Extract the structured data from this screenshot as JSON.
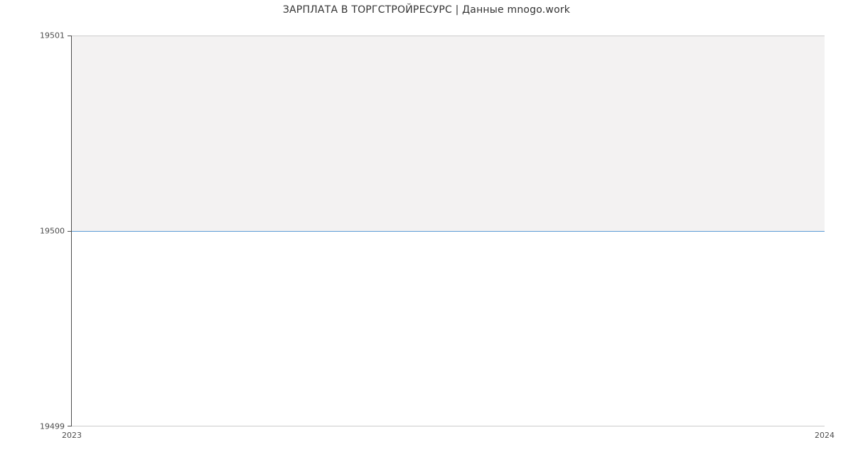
{
  "chart_data": {
    "type": "area",
    "title": "ЗАРПЛАТА В ТОРГСТРОЙРЕСУРС | Данные mnogo.work",
    "x": [
      2023,
      2024
    ],
    "y": [
      19500,
      19500
    ],
    "xlabel": "",
    "ylabel": "",
    "xlim": [
      2023,
      2024
    ],
    "ylim": [
      19499,
      19501
    ],
    "x_ticks": [
      2023,
      2024
    ],
    "y_ticks": [
      19499,
      19500,
      19501
    ],
    "fill_between": {
      "y0": 19500,
      "y1": 19501,
      "color": "#f3f2f2"
    },
    "line_color": "#5b9bd5"
  },
  "axis": {
    "y_tick_top": "19501",
    "y_tick_mid": "19500",
    "y_tick_bot": "19499",
    "x_tick_left": "2023",
    "x_tick_right": "2024"
  }
}
